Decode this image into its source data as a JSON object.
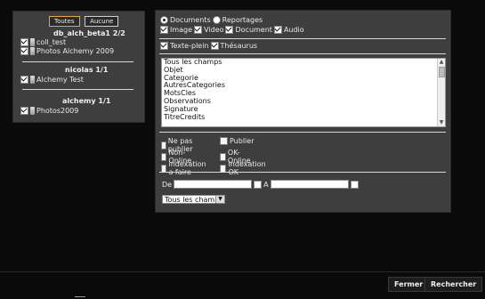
{
  "left": {
    "btn_all": "Toutes",
    "btn_none": "Aucune",
    "groups": [
      {
        "title": "db_alch_beta1 2/2",
        "items": [
          "coll_test",
          "Photos Alchemy 2009"
        ]
      },
      {
        "title": "nicolas 1/1",
        "items": [
          "Alchemy Test"
        ]
      },
      {
        "title": "alchemy 1/1",
        "items": [
          "Photos2009"
        ]
      }
    ]
  },
  "right": {
    "radio_documents": "Documents",
    "radio_reportages": "Reportages",
    "types": {
      "image": "Image",
      "video": "Video",
      "document": "Document",
      "audio": "Audio"
    },
    "search_mode": {
      "fulltext": "Texte-plein",
      "thesaurus": "Thésaurus"
    },
    "fields": [
      "Tous les champs",
      "Objet",
      "Categorie",
      "AutresCategories",
      "MotsCles",
      "Observations",
      "Signature",
      "TitreCredits"
    ],
    "status": {
      "not_publish": "Ne pas publier",
      "publish": "Publier",
      "non_online": "Non-Online",
      "ok_online": "OK-Online",
      "index_todo": "indexation a faire",
      "index_ok": "Indexation OK"
    },
    "date": {
      "from_label": "De",
      "to_label": "A"
    },
    "field_select": "Tous les champs"
  },
  "footer": {
    "close": "Fermer",
    "search": "Rechercher"
  }
}
